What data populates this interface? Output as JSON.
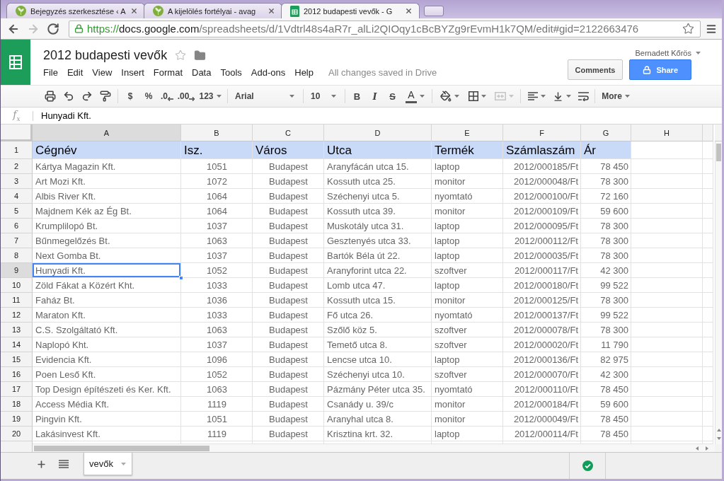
{
  "browser": {
    "tabs": [
      {
        "title": "Bejegyzés szerkesztése ‹ A",
        "kind": "web",
        "selected": false
      },
      {
        "title": "A kijelölés fortélyai - avag",
        "kind": "web",
        "selected": false
      },
      {
        "title": "2012 budapesti vevők - G",
        "kind": "spreadsheet",
        "selected": true
      }
    ],
    "nav_buttons": [
      {
        "kind": "back",
        "disabled": false
      },
      {
        "kind": "forward",
        "disabled": true
      },
      {
        "kind": "reload",
        "disabled": false
      }
    ],
    "url": {
      "scheme": "https://",
      "host": "docs.google.com",
      "path": "/spreadsheets/d/1Vdtrl48s4aR7r_alLi2QIOqy1cBcBYZg9rEvmH1k7QM/edit#gid=2122663476"
    }
  },
  "document": {
    "title": "2012 budapesti vevők",
    "starred": false,
    "menu": [
      "File",
      "Edit",
      "View",
      "Insert",
      "Format",
      "Data",
      "Tools",
      "Add-ons",
      "Help"
    ],
    "save_status": "All changes saved in Drive",
    "user": "Bernadett Kőrös",
    "buttons": [
      {
        "label": "Comments",
        "kind": "secondary"
      },
      {
        "label": "Share",
        "kind": "primary"
      }
    ]
  },
  "toolbar": {
    "currency": "$",
    "percent": "%",
    "decrease_decimals": ".0",
    "increase_decimals": ".00",
    "number_format": "123",
    "font": "Arial",
    "font_size": "10",
    "bold": "B",
    "italic": "I",
    "strikethrough": "S",
    "text_color": "A",
    "merge": {
      "disabled": true
    },
    "more": "More"
  },
  "formula_bar": {
    "label": "f$_{x}$",
    "value": "Hunyadi Kft."
  },
  "sheet": {
    "columns": [
      {
        "label": "A",
        "selected": true
      },
      {
        "label": "B",
        "selected": false
      },
      {
        "label": "C",
        "selected": false
      },
      {
        "label": "D",
        "selected": false
      },
      {
        "label": "E",
        "selected": false
      },
      {
        "label": "F",
        "selected": false
      },
      {
        "label": "G",
        "selected": false
      },
      {
        "label": "H",
        "selected": false
      }
    ],
    "rows": [
      {
        "number": "1",
        "kind": "header",
        "selected": false,
        "cells": [
          "Cégnév",
          "Isz.",
          "Város",
          "Utca",
          "Termék",
          "Számlaszám",
          "Ár"
        ]
      },
      {
        "number": "2",
        "kind": "data",
        "selected": false,
        "cells": [
          "Kártya Magazin Kft.",
          "1051",
          "Budapest",
          "Aranyfácán utca 15.",
          "laptop",
          "2012/000185/Ft",
          "78 450"
        ]
      },
      {
        "number": "3",
        "kind": "data",
        "selected": false,
        "cells": [
          "Art Mozi Kft.",
          "1072",
          "Budapest",
          "Kossuth utca 25.",
          "monitor",
          "2012/000048/Ft",
          "78 300"
        ]
      },
      {
        "number": "4",
        "kind": "data",
        "selected": false,
        "cells": [
          "Albis River Kft.",
          "1064",
          "Budapest",
          "Széchenyi utca 5.",
          "nyomtató",
          "2012/000100/Ft",
          "72 160"
        ]
      },
      {
        "number": "5",
        "kind": "data",
        "selected": false,
        "cells": [
          "Majdnem Kék az Ég Bt.",
          "1064",
          "Budapest",
          "Kossuth utca 39.",
          "monitor",
          "2012/000109/Ft",
          "59 600"
        ]
      },
      {
        "number": "6",
        "kind": "data",
        "selected": false,
        "cells": [
          "Krumplilopó Bt.",
          "1037",
          "Budapest",
          "Muskotály utca 31.",
          "laptop",
          "2012/000095/Ft",
          "78 300"
        ]
      },
      {
        "number": "7",
        "kind": "data",
        "selected": false,
        "cells": [
          "Bűnmegelőzés Bt.",
          "1063",
          "Budapest",
          "Gesztenyés utca 33.",
          "laptop",
          "2012/000112/Ft",
          "78 300"
        ]
      },
      {
        "number": "8",
        "kind": "data",
        "selected": false,
        "cells": [
          "Next Gomba Bt.",
          "1037",
          "Budapest",
          "Bartók Béla út 22.",
          "laptop",
          "2012/000035/Ft",
          "78 300"
        ]
      },
      {
        "number": "9",
        "kind": "data",
        "selected": true,
        "cells": [
          "Hunyadi Kft.",
          "1052",
          "Budapest",
          "Aranyforint utca 22.",
          "szoftver",
          "2012/000117/Ft",
          "42 300"
        ]
      },
      {
        "number": "10",
        "kind": "data",
        "selected": false,
        "cells": [
          "Zöld Fákat a Közért Kht.",
          "1033",
          "Budapest",
          "Lomb utca 47.",
          "laptop",
          "2012/000180/Ft",
          "99 522"
        ]
      },
      {
        "number": "11",
        "kind": "data",
        "selected": false,
        "cells": [
          "Faház Bt.",
          "1036",
          "Budapest",
          "Kossuth utca 15.",
          "monitor",
          "2012/000125/Ft",
          "78 300"
        ]
      },
      {
        "number": "12",
        "kind": "data",
        "selected": false,
        "cells": [
          "Maraton Kft.",
          "1033",
          "Budapest",
          "Fő utca 26.",
          "nyomtató",
          "2012/000137/Ft",
          "99 522"
        ]
      },
      {
        "number": "13",
        "kind": "data",
        "selected": false,
        "cells": [
          "C.S. Szolgáltató Kft.",
          "1063",
          "Budapest",
          "Szőlő köz 5.",
          "szoftver",
          "2012/000078/Ft",
          "78 300"
        ]
      },
      {
        "number": "14",
        "kind": "data",
        "selected": false,
        "cells": [
          "Naplopó Kht.",
          "1037",
          "Budapest",
          "Temető utca 8.",
          "szoftver",
          "2012/000020/Ft",
          "11 790"
        ]
      },
      {
        "number": "15",
        "kind": "data",
        "selected": false,
        "cells": [
          "Evidencia Kft.",
          "1096",
          "Budapest",
          "Lencse utca 10.",
          "laptop",
          "2012/000136/Ft",
          "82 975"
        ]
      },
      {
        "number": "16",
        "kind": "data",
        "selected": false,
        "cells": [
          "Poen Leső Kft.",
          "1052",
          "Budapest",
          "Széchenyi utca 10.",
          "szoftver",
          "2012/000070/Ft",
          "42 300"
        ]
      },
      {
        "number": "17",
        "kind": "data",
        "selected": false,
        "cells": [
          "Top Design építészeti és Ker. Kft.",
          "1063",
          "Budapest",
          "Pázmány Péter utca 35.",
          "nyomtató",
          "2012/000110/Ft",
          "78 450"
        ]
      },
      {
        "number": "18",
        "kind": "data",
        "selected": false,
        "cells": [
          "Access Média Kft.",
          "1119",
          "Budapest",
          "Csanády u. 39/c",
          "monitor",
          "2012/000184/Ft",
          "59 600"
        ]
      },
      {
        "number": "19",
        "kind": "data",
        "selected": false,
        "cells": [
          "Pingvin Kft.",
          "1051",
          "Budapest",
          "Aranyhal utca 8.",
          "monitor",
          "2012/000049/Ft",
          "78 450"
        ]
      },
      {
        "number": "20",
        "kind": "data",
        "selected": false,
        "cells": [
          "Lakásinvest Kft.",
          "1119",
          "Budapest",
          "Krisztina krt. 32.",
          "laptop",
          "2012/000114/Ft",
          "78 450"
        ]
      }
    ]
  },
  "sheet_tabs": [
    {
      "label": "vevők",
      "selected": true
    }
  ]
}
